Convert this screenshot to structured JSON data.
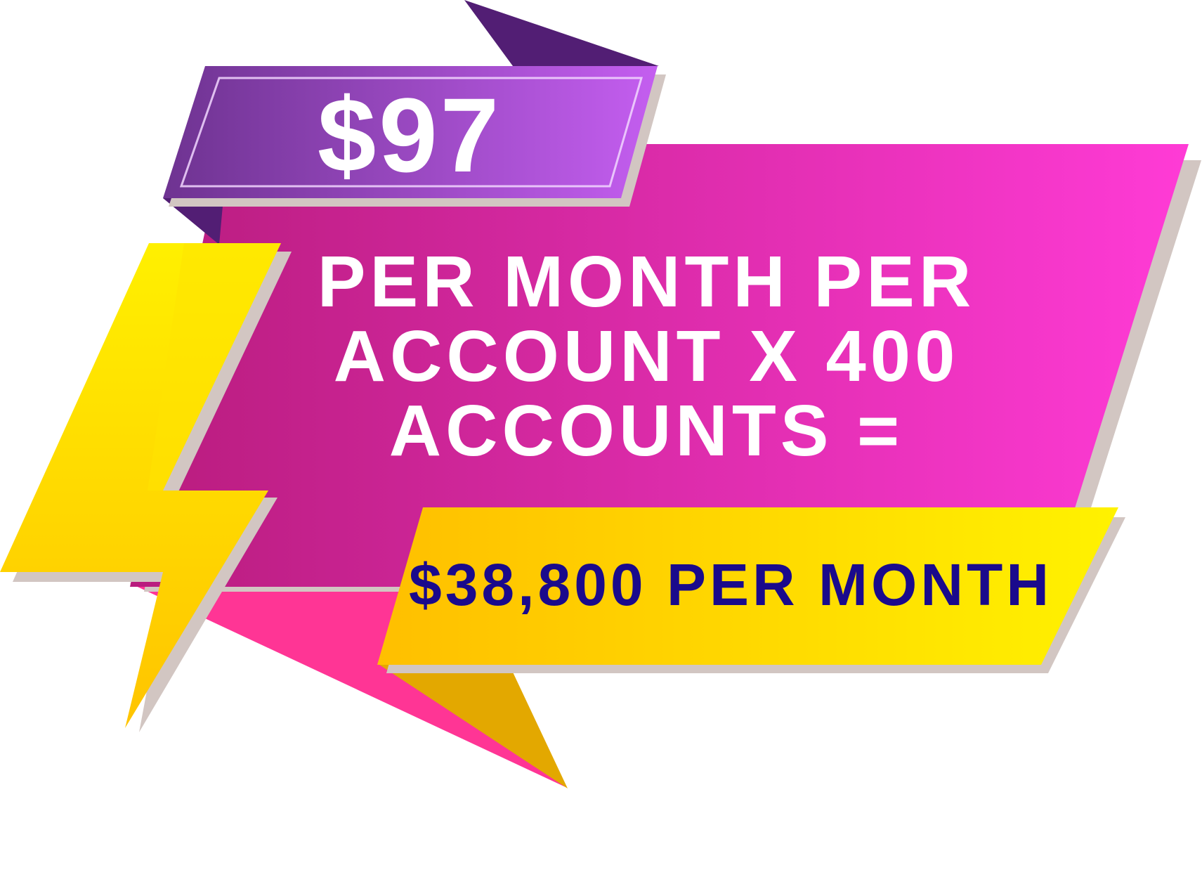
{
  "banner": {
    "price": "$97",
    "description": "PER MONTH PER ACCOUNT X 400 ACCOUNTS =",
    "total": "$38,800 PER MONTH"
  },
  "colors": {
    "price_text": "#ffffff",
    "description_text": "#ffffff",
    "total_text": "#1a0a8c",
    "ribbon_purple_left": "#6e3391",
    "ribbon_purple_right": "#c45ef0",
    "banner_pink_left": "#b81c7d",
    "banner_pink_right": "#ff3bd6",
    "bolt_yellow": "#ffd800",
    "tail_pink": "#ff3595",
    "tail_gold": "#e3a800"
  },
  "icons": {
    "bolt": "lightning-bolt-icon"
  }
}
